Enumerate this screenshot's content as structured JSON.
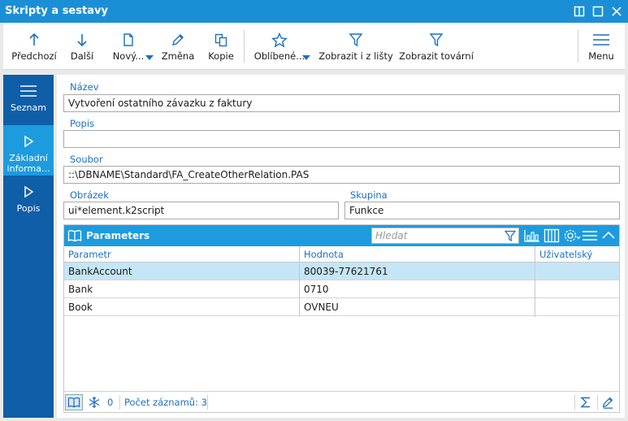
{
  "window": {
    "title": "Skripty a sestavy"
  },
  "toolbar": {
    "items": [
      {
        "label": "Předchozí",
        "icon": "arrow-up-icon"
      },
      {
        "label": "Další",
        "icon": "arrow-down-icon"
      },
      {
        "label": "Nový...",
        "icon": "new-document-icon"
      },
      {
        "label": "Změna",
        "icon": "pencil-icon"
      },
      {
        "label": "Kopie",
        "icon": "copy-icon"
      },
      {
        "label": "Oblíbené...",
        "icon": "star-icon"
      },
      {
        "label": "Zobrazit i z lišty",
        "icon": "filter-icon"
      },
      {
        "label": "Zobrazit tovární",
        "icon": "filter-icon"
      },
      {
        "label": "Menu",
        "icon": "hamburger-icon"
      }
    ]
  },
  "sidebar": {
    "items": [
      {
        "label": "Seznam",
        "icon": "list-icon"
      },
      {
        "label": "Základní informa...",
        "icon": "play-icon"
      },
      {
        "label": "Popis",
        "icon": "play-icon"
      }
    ]
  },
  "form": {
    "nazev_label": "Název",
    "nazev_value": "Vytvoření ostatního závazku z faktury",
    "popis_label": "Popis",
    "popis_value": "",
    "soubor_label": "Soubor",
    "soubor_value": "::\\DBNAME\\Standard\\FA_CreateOtherRelation.PAS",
    "obrazek_label": "Obrázek",
    "obrazek_value": "ui*element.k2script",
    "skupina_label": "Skupina",
    "skupina_value": "Funkce"
  },
  "grid": {
    "title": "Parameters",
    "search_placeholder": "Hledat",
    "columns": [
      "Parametr",
      "Hodnota",
      "Uživatelský vstup"
    ],
    "rows": [
      [
        "BankAccount",
        "80039-77621761",
        ""
      ],
      [
        "Bank",
        "0710",
        ""
      ],
      [
        "Book",
        "OVNEU",
        ""
      ]
    ],
    "footer": {
      "count_value": "0",
      "records_text": "Počet záznamů: 3"
    }
  },
  "colors": {
    "title_bar": "#1b8fd6",
    "sidebar": "#0e5ea8",
    "sidebar_active": "#1d9bdf",
    "accent_text": "#1b6fc4",
    "selected_row": "#c5e6f7"
  }
}
